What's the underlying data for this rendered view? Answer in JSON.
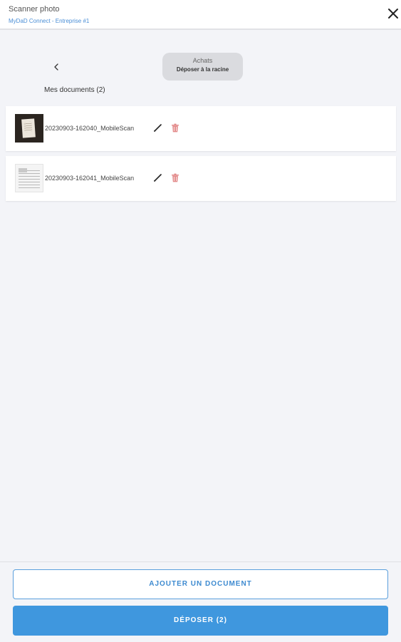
{
  "header": {
    "title": "Scanner photo",
    "subtitle": "MyDaD Connect - Entreprise #1"
  },
  "folder": {
    "name": "Achats",
    "action": "Déposer à la racine"
  },
  "documents": {
    "heading": "Mes documents (2)",
    "items": [
      {
        "name": "20230903-162040_MobileScan",
        "thumbnail": "dark-photo-of-receipt"
      },
      {
        "name": "20230903-162041_MobileScan",
        "thumbnail": "white-document-page"
      }
    ]
  },
  "footer": {
    "add_label": "AJOUTER UN DOCUMENT",
    "submit_label": "DÉPOSER (2)"
  },
  "icons": {
    "close": "close-icon",
    "back": "chevron-left-icon",
    "edit": "pencil-icon",
    "delete": "trash-icon"
  },
  "colors": {
    "accent": "#3f97de",
    "accent_text": "#3d8ad0",
    "subtitle": "#4a8ed6",
    "delete": "#e38a8a",
    "background": "#f3f4f8"
  }
}
